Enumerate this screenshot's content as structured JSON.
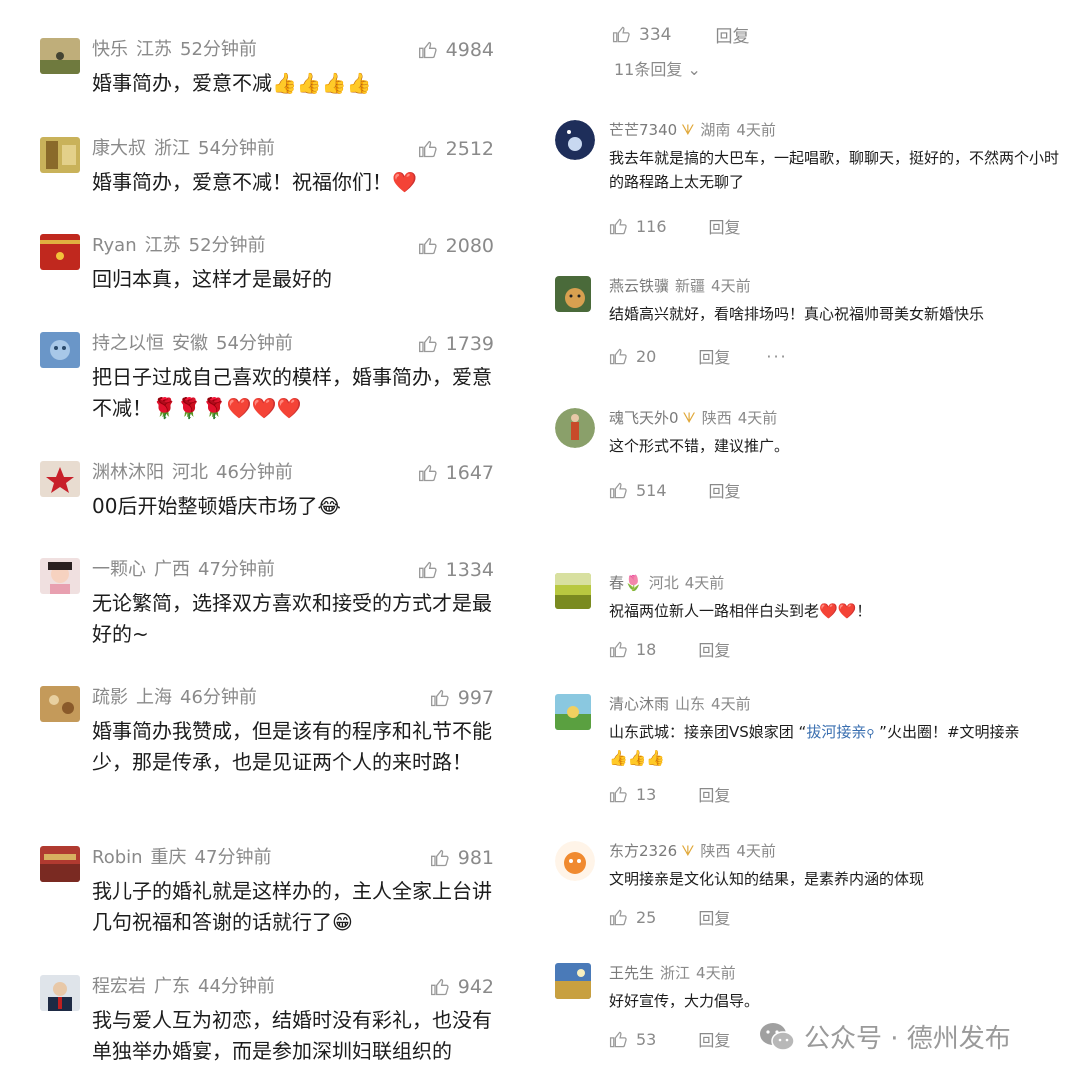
{
  "left_comments": [
    {
      "name": "快乐",
      "region": "江苏",
      "time": "52分钟前",
      "likes": "4984",
      "text": "婚事简办，爱意不减👍👍👍👍"
    },
    {
      "name": "康大叔",
      "region": "浙江",
      "time": "54分钟前",
      "likes": "2512",
      "text": "婚事简办，爱意不减！祝福你们！❤️"
    },
    {
      "name": "Ryan",
      "region": "江苏",
      "time": "52分钟前",
      "likes": "2080",
      "text": "回归本真，这样才是最好的"
    },
    {
      "name": "持之以恒",
      "region": "安徽",
      "time": "54分钟前",
      "likes": "1739",
      "text": "把日子过成自己喜欢的模样，婚事简办，爱意不减！🌹🌹🌹❤️❤️❤️"
    },
    {
      "name": "渊林沐阳",
      "region": "河北",
      "time": "46分钟前",
      "likes": "1647",
      "text": "00后开始整顿婚庆市场了😂"
    },
    {
      "name": "一颗心",
      "region": "广西",
      "time": "47分钟前",
      "likes": "1334",
      "text": "无论繁简，选择双方喜欢和接受的方式才是最好的~"
    },
    {
      "name": "疏影",
      "region": "上海",
      "time": "46分钟前",
      "likes": "997",
      "text": "婚事简办我赞成，但是该有的程序和礼节不能少，那是传承，也是见证两个人的来时路！"
    },
    {
      "name": "Robin",
      "region": "重庆",
      "time": "47分钟前",
      "likes": "981",
      "text": "我儿子的婚礼就是这样办的，主人全家上台讲几句祝福和答谢的话就行了😁"
    },
    {
      "name": "程宏岩",
      "region": "广东",
      "time": "44分钟前",
      "likes": "942",
      "text": "我与爱人互为初恋，结婚时没有彩礼，也没有单独举办婚宴，而是参加深圳妇联组织的"
    }
  ],
  "top_actions": {
    "likes": "334",
    "reply": "回复",
    "replies_link": "11条回复"
  },
  "right_comments": [
    {
      "name": "芒芒7340",
      "region": "湖南",
      "time": "4天前",
      "text": "我去年就是搞的大巴车，一起唱歌，聊聊天，挺好的，不然两个小时的路程路上太无聊了",
      "likes": "116",
      "reply": "回复"
    },
    {
      "name": "燕云铁骥",
      "region": "新疆",
      "time": "4天前",
      "text": "结婚高兴就好，看啥排场吗！真心祝福帅哥美女新婚快乐",
      "likes": "20",
      "reply": "回复",
      "more": "···"
    },
    {
      "name": "魂飞天外0",
      "region": "陕西",
      "time": "4天前",
      "text": "这个形式不错，建议推广。",
      "likes": "514",
      "reply": "回复"
    },
    {
      "name": "春🌷",
      "region": "河北",
      "time": "4天前",
      "text": "祝福两位新人一路相伴白头到老❤️❤️！",
      "likes": "18",
      "reply": "回复"
    },
    {
      "name": "清心沐雨",
      "region": "山东",
      "time": "4天前",
      "text_pre": "山东武城：接亲团VS娘家团 “",
      "text_link": "拔河接亲",
      "text_post": " ”火出圈！#文明接亲",
      "text_line2": "👍👍👍",
      "likes": "13",
      "reply": "回复"
    },
    {
      "name": "东方2326",
      "region": "陕西",
      "time": "4天前",
      "text": "文明接亲是文化认知的结果，是素养内涵的体现",
      "likes": "25",
      "reply": "回复"
    },
    {
      "name": "王先生",
      "region": "浙江",
      "time": "4天前",
      "text": "好好宣传，大力倡导。",
      "likes": "53",
      "reply": "回复"
    }
  ],
  "watermark": {
    "label": "公众号 · 德州发布"
  }
}
